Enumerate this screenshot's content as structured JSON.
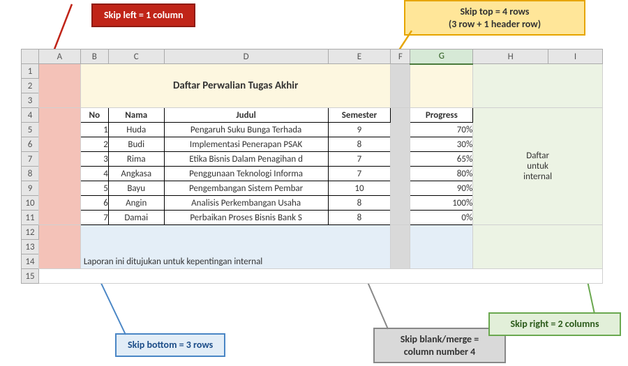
{
  "callouts": {
    "skip_left": "Skip left = 1 column",
    "skip_top_l1": "Skip top = 4 rows",
    "skip_top_l2": "(3 row + 1 header row)",
    "skip_bottom": "Skip bottom = 3 rows",
    "skip_merge_l1": "Skip blank/merge =",
    "skip_merge_l2": "column number 4",
    "skip_right": "Skip right = 2 columns"
  },
  "colhdrs": [
    "A",
    "B",
    "C",
    "D",
    "E",
    "F",
    "G",
    "H",
    "I"
  ],
  "rowhdrs": [
    "1",
    "2",
    "3",
    "4",
    "5",
    "6",
    "7",
    "8",
    "9",
    "10",
    "11",
    "12",
    "13",
    "14",
    "15"
  ],
  "title": "Daftar Perwalian Tugas Akhir",
  "side_label_l1": "Daftar",
  "side_label_l2": "untuk",
  "side_label_l3": "internal",
  "footer_text": "Laporan ini ditujukan untuk kepentingan internal",
  "columns": {
    "no": "No",
    "nama": "Nama",
    "judul": "Judul",
    "semester": "Semester",
    "progress": "Progress"
  },
  "rows": [
    {
      "no": "1",
      "nama": "Huda",
      "judul": "Pengaruh Suku Bunga Terhada",
      "semester": "9",
      "progress": "70%"
    },
    {
      "no": "2",
      "nama": "Budi",
      "judul": "Implementasi Penerapan PSAK",
      "semester": "8",
      "progress": "30%"
    },
    {
      "no": "3",
      "nama": "Rima",
      "judul": "Etika Bisnis Dalam Penagihan d",
      "semester": "7",
      "progress": "65%"
    },
    {
      "no": "4",
      "nama": "Angkasa",
      "judul": "Penggunaan Teknologi Informa",
      "semester": "7",
      "progress": "80%"
    },
    {
      "no": "5",
      "nama": "Bayu",
      "judul": "Pengembangan Sistem Pembar",
      "semester": "10",
      "progress": "90%"
    },
    {
      "no": "6",
      "nama": "Angin",
      "judul": "Analisis Perkembangan Usaha",
      "semester": "8",
      "progress": "100%"
    },
    {
      "no": "7",
      "nama": "Damai",
      "judul": "Perbaikan Proses Bisnis Bank S",
      "semester": "8",
      "progress": "0%"
    }
  ],
  "chart_data": {
    "type": "table",
    "title": "Daftar Perwalian Tugas Akhir",
    "columns": [
      "No",
      "Nama",
      "Judul",
      "Semester",
      "Progress"
    ],
    "rows": [
      [
        1,
        "Huda",
        "Pengaruh Suku Bunga Terhada",
        9,
        0.7
      ],
      [
        2,
        "Budi",
        "Implementasi Penerapan PSAK",
        8,
        0.3
      ],
      [
        3,
        "Rima",
        "Etika Bisnis Dalam Penagihan d",
        7,
        0.65
      ],
      [
        4,
        "Angkasa",
        "Penggunaan Teknologi Informa",
        7,
        0.8
      ],
      [
        5,
        "Bayu",
        "Pengembangan Sistem Pembar",
        10,
        0.9
      ],
      [
        6,
        "Angin",
        "Analisis Perkembangan Usaha",
        8,
        1.0
      ],
      [
        7,
        "Damai",
        "Perbaikan Proses Bisnis Bank S",
        8,
        0.0
      ]
    ],
    "annotations": {
      "skip_left_columns": 1,
      "skip_top_rows": 4,
      "skip_bottom_rows": 3,
      "skip_right_columns": 2,
      "skip_merge_column_index": 4
    }
  }
}
